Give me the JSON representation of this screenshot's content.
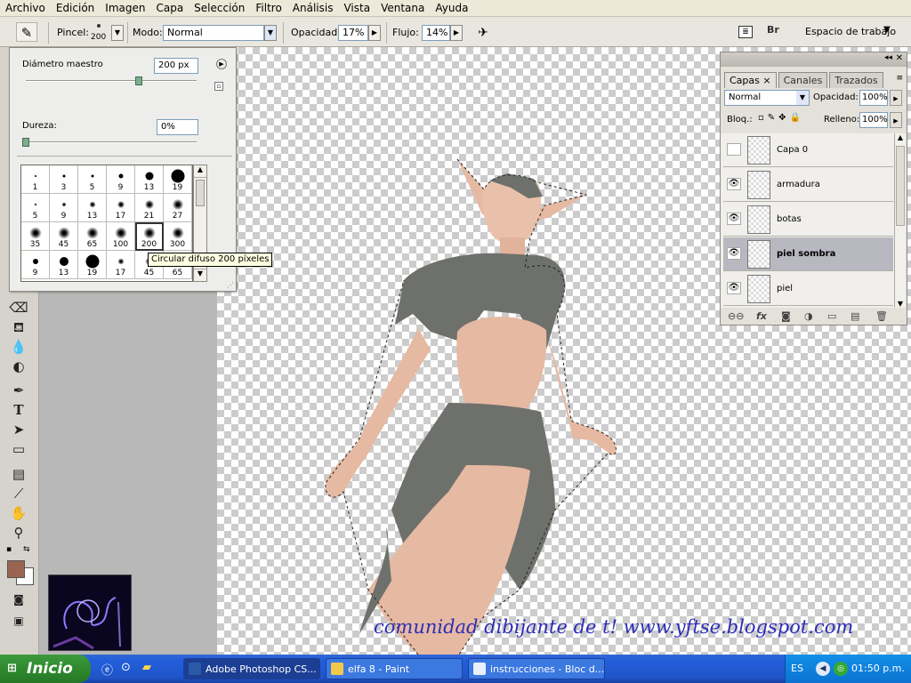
{
  "menu": [
    "Archivo",
    "Edición",
    "Imagen",
    "Capa",
    "Selección",
    "Filtro",
    "Análisis",
    "Vista",
    "Ventana",
    "Ayuda"
  ],
  "options": {
    "brush_label": "Pincel:",
    "brush_size": "200",
    "mode_label": "Modo:",
    "mode_value": "Normal",
    "opacity_label": "Opacidad:",
    "opacity_value": "17%",
    "flow_label": "Flujo:",
    "flow_value": "14%",
    "workspace_label": "Espacio de trabajo"
  },
  "brush_panel": {
    "diameter_label": "Diámetro maestro",
    "diameter_value": "200 px",
    "diameter_level": 0.66,
    "hardness_label": "Dureza:",
    "hardness_value": "0%",
    "hardness_level": 0.0,
    "brushes": [
      {
        "size": "1",
        "d": 2,
        "soft": false
      },
      {
        "size": "3",
        "d": 3,
        "soft": false
      },
      {
        "size": "5",
        "d": 3,
        "soft": false
      },
      {
        "size": "9",
        "d": 5,
        "soft": false
      },
      {
        "size": "13",
        "d": 9,
        "soft": false
      },
      {
        "size": "19",
        "d": 15,
        "soft": false
      },
      {
        "size": "5",
        "d": 3,
        "soft": true
      },
      {
        "size": "9",
        "d": 5,
        "soft": true
      },
      {
        "size": "13",
        "d": 7,
        "soft": true
      },
      {
        "size": "17",
        "d": 8,
        "soft": true
      },
      {
        "size": "21",
        "d": 10,
        "soft": true
      },
      {
        "size": "27",
        "d": 12,
        "soft": true
      },
      {
        "size": "35",
        "d": 13,
        "soft": true
      },
      {
        "size": "45",
        "d": 13,
        "soft": true
      },
      {
        "size": "65",
        "d": 13,
        "soft": true
      },
      {
        "size": "100",
        "d": 13,
        "soft": true
      },
      {
        "size": "200",
        "d": 13,
        "soft": true,
        "selected": true
      },
      {
        "size": "300",
        "d": 13,
        "soft": true
      },
      {
        "size": "9",
        "d": 6,
        "soft": false
      },
      {
        "size": "13",
        "d": 10,
        "soft": false
      },
      {
        "size": "19",
        "d": 15,
        "soft": false
      },
      {
        "size": "17",
        "d": 7,
        "soft": true
      },
      {
        "size": "45",
        "d": 9,
        "soft": true
      },
      {
        "size": "65",
        "d": 9,
        "soft": true
      }
    ],
    "tooltip": "Circular difuso 200 píxeles"
  },
  "layers_panel": {
    "tabs": [
      "Capas",
      "Canales",
      "Trazados"
    ],
    "blend_mode": "Normal",
    "opacity_label": "Opacidad:",
    "opacity_value": "100%",
    "lock_label": "Bloq.:",
    "fill_label": "Relleno:",
    "fill_value": "100%",
    "layers": [
      {
        "name": "Capa 0",
        "visible": false,
        "selected": false
      },
      {
        "name": "armadura",
        "visible": true,
        "selected": false
      },
      {
        "name": "botas",
        "visible": true,
        "selected": false
      },
      {
        "name": "piel sombra",
        "visible": true,
        "selected": true
      },
      {
        "name": "piel",
        "visible": true,
        "selected": false
      }
    ]
  },
  "colors": {
    "foreground": "#9a6450",
    "background": "#ffffff",
    "skin": "#e6b9a2",
    "armor": "#6e706b",
    "text_sig": "#2d2db8"
  },
  "watermark": "comunidad dibijante de t! www.yftse.blogspot.com",
  "taskbar": {
    "start": "Inicio",
    "tasks": [
      {
        "label": "Adobe Photoshop CS...",
        "color": "#1c3f94",
        "active": true
      },
      {
        "label": "elfa 8 - Paint",
        "color": "#3b78e0",
        "active": false
      },
      {
        "label": "instrucciones - Bloc d...",
        "color": "#3b78e0",
        "active": false
      }
    ],
    "lang": "ES",
    "time": "01:50 p.m."
  }
}
